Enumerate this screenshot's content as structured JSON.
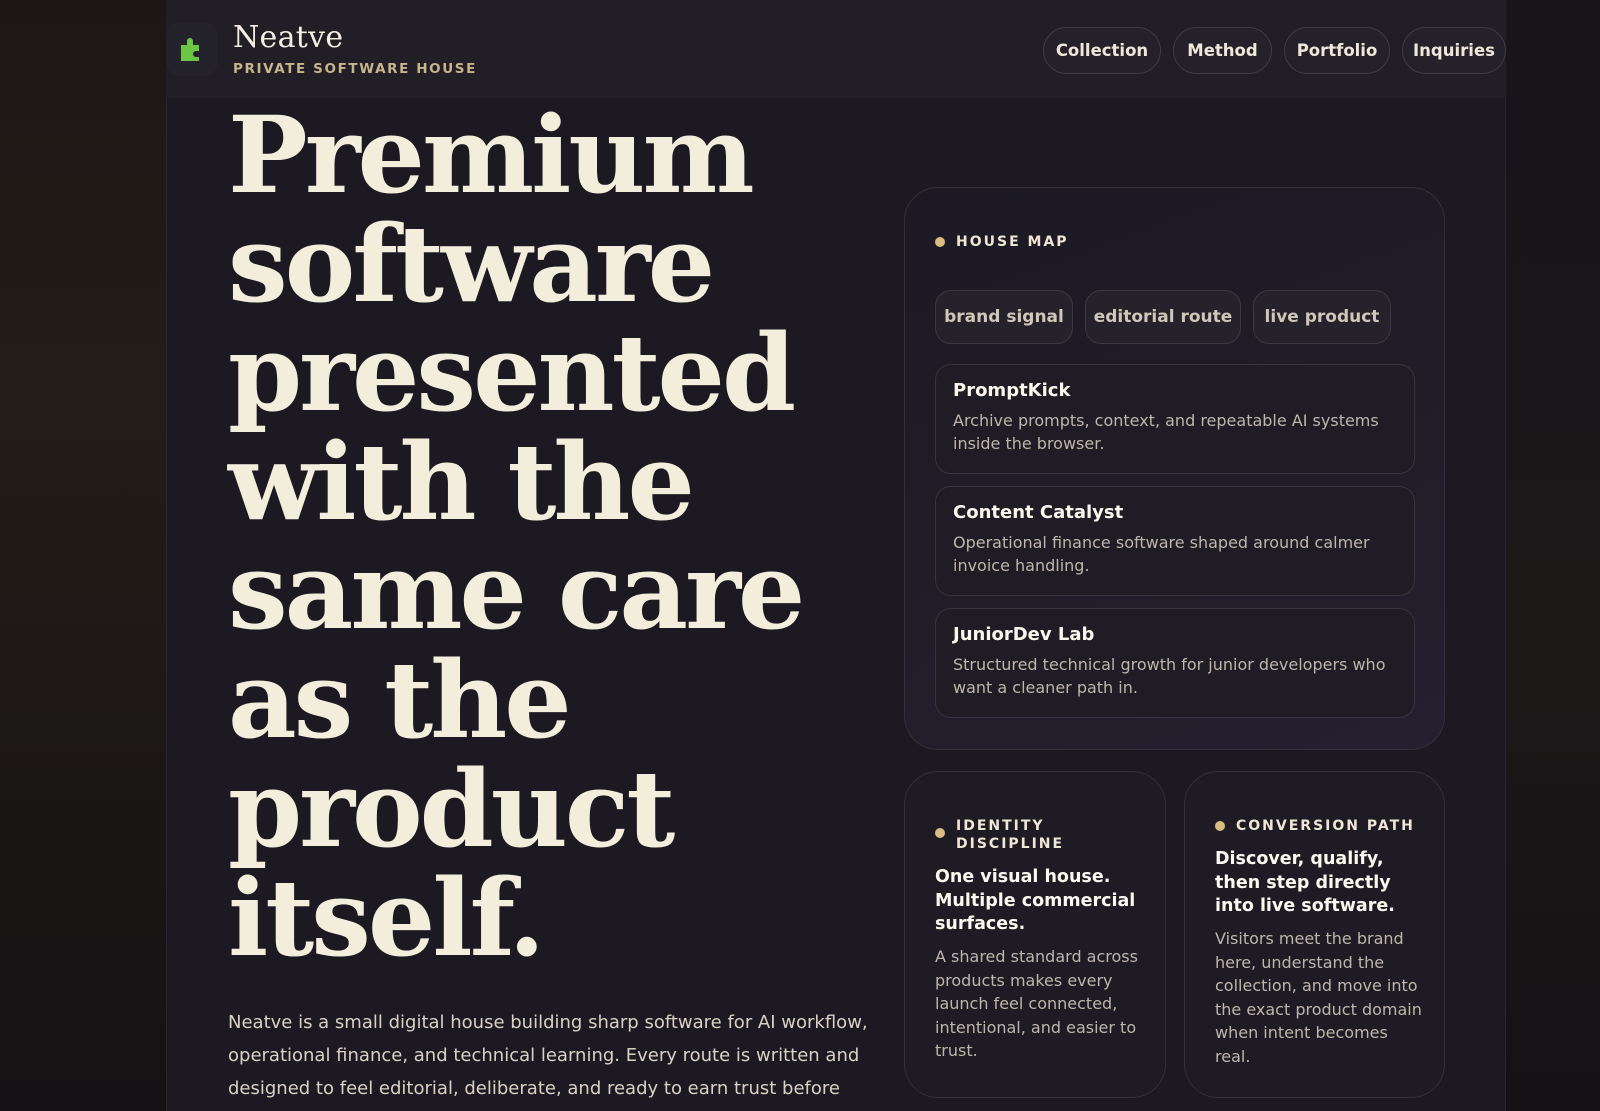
{
  "brand": {
    "name": "Neatve",
    "tagline": "PRIVATE SOFTWARE HOUSE",
    "logo_icon": "puzzle-piece-icon",
    "logo_color": "#6cc644"
  },
  "nav": {
    "items": [
      {
        "label": "Collection"
      },
      {
        "label": "Method"
      },
      {
        "label": "Portfolio"
      },
      {
        "label": "Inquiries"
      }
    ]
  },
  "hero": {
    "lines": [
      "Premium",
      "software",
      "presented",
      "with the",
      "same care",
      "as the",
      "product",
      "itself."
    ],
    "intro": "Neatve is a small digital house building sharp software for AI workflow, operational finance, and technical learning. Every route is written and designed to feel editorial, deliberate, and ready to earn trust before the"
  },
  "house_map": {
    "label": "HOUSE MAP",
    "tags": [
      "brand signal",
      "editorial route",
      "live product"
    ],
    "projects": [
      {
        "title": "PromptKick",
        "description": "Archive prompts, context, and repeatable AI systems inside the browser."
      },
      {
        "title": "Content Catalyst",
        "description": "Operational finance software shaped around calmer invoice handling."
      },
      {
        "title": "JuniorDev Lab",
        "description": "Structured technical growth for junior developers who want a cleaner path in."
      }
    ]
  },
  "identity": {
    "label_line1": "IDENTITY",
    "label_line2": "DISCIPLINE",
    "title": "One visual house. Multiple commercial surfaces.",
    "description": "A shared standard across products makes every launch feel connected, intentional, and easier to trust."
  },
  "conversion": {
    "label": "CONVERSION PATH",
    "title": "Discover, qualify, then step directly into live software.",
    "description": "Visitors meet the brand here, understand the collection, and move into the exact product domain when intent becomes real."
  },
  "colors": {
    "accent": "#d9bd82",
    "background": "#1c1922",
    "text": "#f3eedc"
  }
}
